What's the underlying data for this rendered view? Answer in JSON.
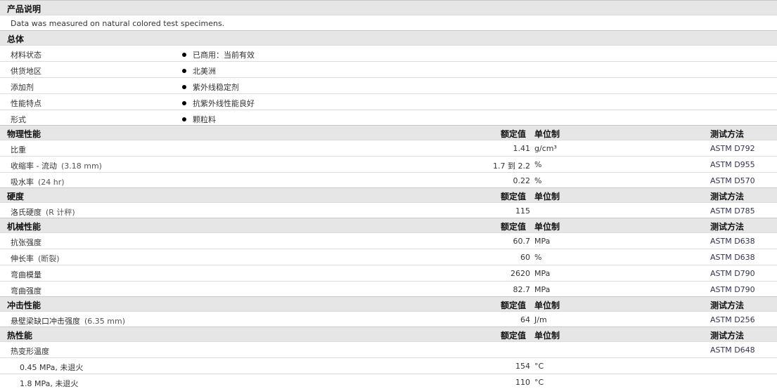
{
  "product": {
    "title": "产品说明",
    "note": "Data was measured on natural colored test specimens."
  },
  "columns": {
    "nominal": "额定值",
    "unit": "单位制",
    "method": "测试方法"
  },
  "general": {
    "title": "总体",
    "rows": [
      {
        "label": "材料状态",
        "value": "已商用：当前有效"
      },
      {
        "label": "供货地区",
        "value": "北美洲"
      },
      {
        "label": "添加剂",
        "value": "紫外线稳定剂"
      },
      {
        "label": "性能特点",
        "value": "抗紫外线性能良好"
      },
      {
        "label": "形式",
        "value": "颗粒料"
      }
    ]
  },
  "physical": {
    "title": "物理性能",
    "rows": [
      {
        "label": "比重",
        "cond": "",
        "value": "1.41",
        "unit": "g/cm³",
        "method": "ASTM D792"
      },
      {
        "label": "收缩率 - 流动",
        "cond": "(3.18 mm)",
        "value": "1.7 到  2.2",
        "unit": "%",
        "method": "ASTM D955"
      },
      {
        "label": "吸水率",
        "cond": "(24 hr)",
        "value": "0.22",
        "unit": "%",
        "method": "ASTM D570"
      }
    ]
  },
  "hardness": {
    "title": "硬度",
    "rows": [
      {
        "label": "洛氏硬度",
        "cond": "(R 计秤)",
        "value": "115",
        "unit": "",
        "method": "ASTM D785"
      }
    ]
  },
  "mechanical": {
    "title": "机械性能",
    "rows": [
      {
        "label": "抗张强度",
        "cond": "",
        "value": "60.7",
        "unit": "MPa",
        "method": "ASTM D638"
      },
      {
        "label": "伸长率",
        "cond": "(断裂)",
        "value": "60",
        "unit": "%",
        "method": "ASTM D638"
      },
      {
        "label": "弯曲模量",
        "cond": "",
        "value": "2620",
        "unit": "MPa",
        "method": "ASTM D790"
      },
      {
        "label": "弯曲强度",
        "cond": "",
        "value": "82.7",
        "unit": "MPa",
        "method": "ASTM D790"
      }
    ]
  },
  "impact": {
    "title": "冲击性能",
    "rows": [
      {
        "label": "悬壁梁缺口冲击强度",
        "cond": "(6.35 mm)",
        "value": "64",
        "unit": "J/m",
        "method": "ASTM D256"
      }
    ]
  },
  "thermal": {
    "title": "热性能",
    "rows": [
      {
        "label": "热变形温度",
        "cond": "",
        "value": "",
        "unit": "",
        "method": "ASTM D648"
      },
      {
        "label": "0.45 MPa, 未退火",
        "cond": "",
        "value": "154",
        "unit": "°C",
        "method": ""
      },
      {
        "label": "1.8 MPa, 未退火",
        "cond": "",
        "value": "110",
        "unit": "°C",
        "method": ""
      }
    ]
  }
}
